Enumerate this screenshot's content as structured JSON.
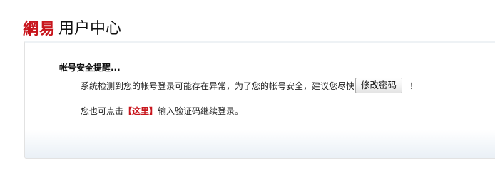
{
  "header": {
    "logo_text": "網易",
    "title": "用户中心",
    "logo_color": "#c8161d"
  },
  "notice": {
    "title": "帐号安全提醒...",
    "line1_text": "系统检测到您的帐号登录可能存在异常，为了您的帐号安全，建议您尽快",
    "change_password_button": "修改密码",
    "line1_end": "！",
    "line2_prefix": "您也可点击",
    "here_link": "【这里】",
    "line2_suffix": "输入验证码继续登录。",
    "link_color": "#c8161d"
  }
}
